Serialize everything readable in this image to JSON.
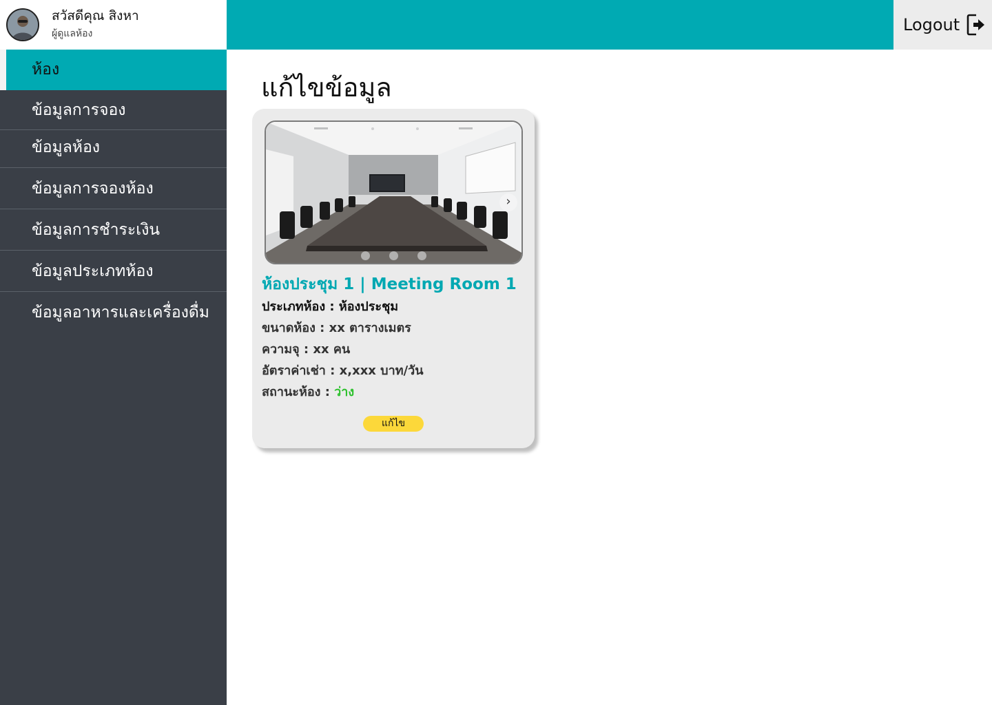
{
  "profile": {
    "name": "สวัสดีคุณ สิงหา",
    "role": "ผู้ดูแลห้อง",
    "avatar_icon": "user-avatar-icon"
  },
  "sidebar": {
    "items": [
      {
        "label": "ห้อง",
        "active": true
      },
      {
        "label": "ข้อมูลการจอง"
      },
      {
        "label": "ข้อมูลห้อง"
      },
      {
        "label": "ข้อมูลการจองห้อง"
      },
      {
        "label": "ข้อมูลการชำระเงิน"
      },
      {
        "label": "ข้อมูลประเภทห้อง"
      },
      {
        "label": "ข้อมูลอาหารและเครื่องดื่ม"
      }
    ]
  },
  "header": {
    "logout_label": "Logout",
    "logout_icon": "logout-icon"
  },
  "main": {
    "title": "แก้ไขข้อมูล",
    "card": {
      "title": "ห้องประชุม 1 | Meeting Room 1",
      "type_label": "ประเภทห้อง : ",
      "type_value": "ห้องประชุม",
      "size_text": "ขนาดห้อง  :   xx ตารางเมตร",
      "capacity_text": "ความจุ :  xx คน",
      "rate_text": "อัตราค่าเช่า : x,xxx บาท/วัน",
      "status_label": "สถานะห้อง : ",
      "status_value": "ว่าง",
      "edit_label": "แก้ไข",
      "carousel_next": "›",
      "carousel_dots": 3
    }
  },
  "colors": {
    "accent": "#00aab3",
    "sidebar": "#3a3f47",
    "status_available": "#2ec12e",
    "edit_button": "#fcd83a"
  }
}
